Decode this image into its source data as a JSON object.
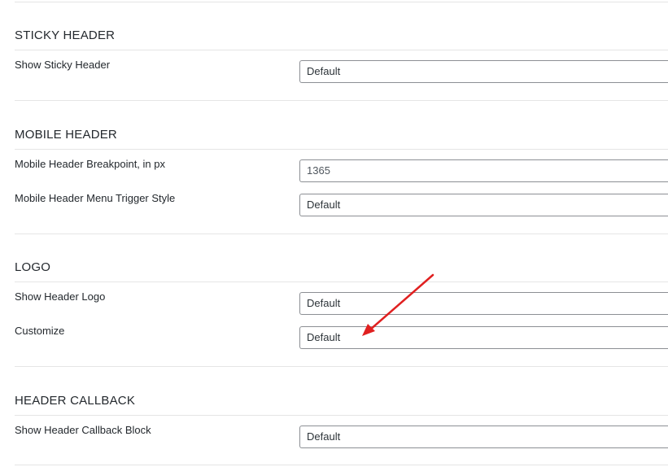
{
  "sections": [
    {
      "title": "STICKY HEADER",
      "rows": [
        {
          "label": "Show Sticky Header",
          "value": "Default"
        }
      ]
    },
    {
      "title": "MOBILE HEADER",
      "rows": [
        {
          "label": "Mobile Header Breakpoint, in px",
          "value": "1365"
        },
        {
          "label": "Mobile Header Menu Trigger Style",
          "value": "Default"
        }
      ]
    },
    {
      "title": "LOGO",
      "rows": [
        {
          "label": "Show Header Logo",
          "value": "Default"
        },
        {
          "label": "Customize",
          "value": "Default"
        }
      ]
    },
    {
      "title": "HEADER CALLBACK",
      "rows": [
        {
          "label": "Show Header Callback Block",
          "value": "Default"
        }
      ]
    }
  ],
  "colors": {
    "annotation_arrow": "#e02020"
  },
  "icons": {
    "annotation": "red-arrow-icon"
  }
}
